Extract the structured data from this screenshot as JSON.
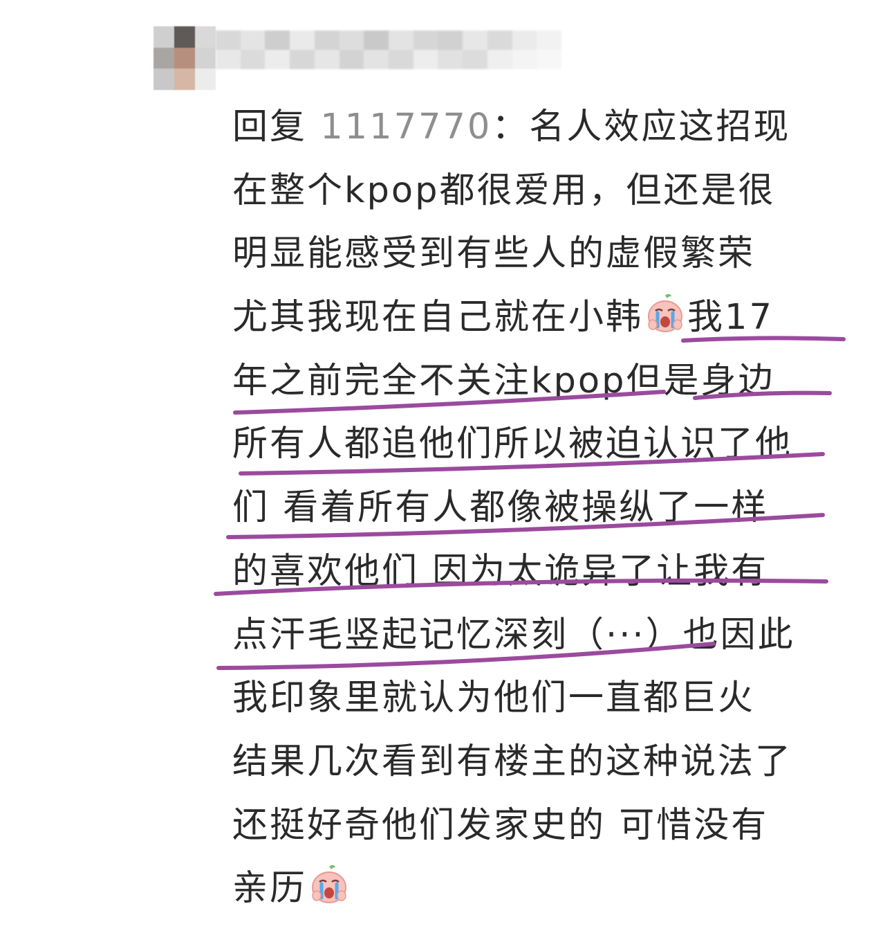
{
  "comment": {
    "reply_prefix": "回复",
    "reply_user": "1117770",
    "colon": "：",
    "lines": [
      "名人效应这招现",
      "在整个kpop都很爱用，但还是很",
      "明显能感受到有些人的虚假繁荣",
      "尤其我现在自己就在小韩",
      "我17",
      "年之前完全不关注kpop但是身边",
      "所有人都追他们所以被迫认识了他",
      "们 看着所有人都像被操纵了一样",
      "的喜欢他们 因为太诡异了让我有",
      "点汗毛竖起记忆深刻（···）也因此",
      "我印象里就认为他们一直都巨火",
      "结果几次看到有楼主的这种说法了",
      "还挺好奇他们发家史的 可惜没有",
      "亲历"
    ],
    "emoji_icon": "crying-face-icon"
  },
  "colors": {
    "text": "#2a2a2a",
    "reply_user": "#8e8e8e",
    "underline": "#9b4a9e"
  }
}
